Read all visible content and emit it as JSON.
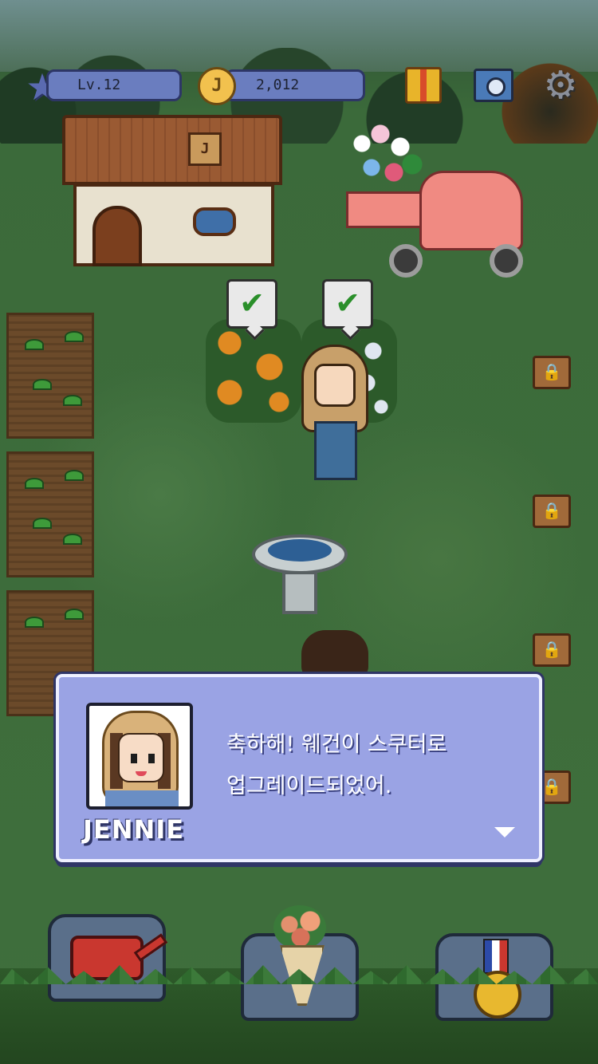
{
  "hud": {
    "level_label": "Lv.12",
    "coin_symbol": "J",
    "coin_amount": "2,012",
    "icons": [
      "star-icon",
      "coin-icon",
      "gift-icon",
      "camera-icon",
      "gear-icon"
    ]
  },
  "house": {
    "sign_symbol": "J"
  },
  "plots": {
    "status": [
      "check",
      "check"
    ],
    "locked_signs": 4
  },
  "dialog": {
    "speaker": "JENNIE",
    "lines": [
      "축하해! 웨건이 스쿠터로",
      "업그레이드되었어."
    ],
    "next_indicator": "down-arrow-icon"
  },
  "bottom_bar": {
    "buttons": [
      {
        "icon": "watering-can-icon"
      },
      {
        "icon": "bouquet-icon"
      },
      {
        "icon": "medal-icon"
      }
    ]
  },
  "colors": {
    "dialog_bg": "#9aa3e4",
    "hud_pill": "#6a7dbf",
    "grass": "#3f6f3c",
    "scooter": "#f08a82"
  }
}
